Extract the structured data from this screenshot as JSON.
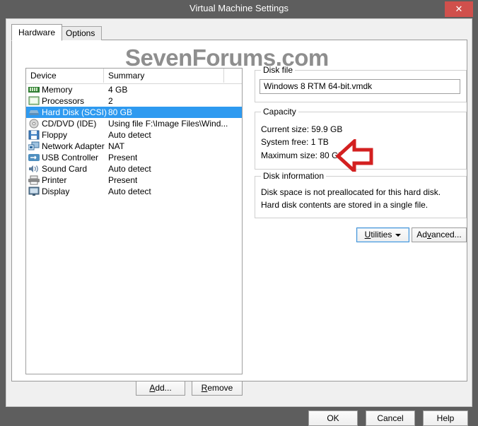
{
  "window": {
    "title": "Virtual Machine Settings",
    "close_label": "✕"
  },
  "watermark": "SevenForums.com",
  "tabs": [
    {
      "label": "Hardware",
      "active": true
    },
    {
      "label": "Options",
      "active": false
    }
  ],
  "device_list": {
    "columns": [
      "Device",
      "Summary",
      ""
    ],
    "rows": [
      {
        "icon": "memory-icon",
        "device": "Memory",
        "summary": "4 GB",
        "selected": false
      },
      {
        "icon": "processor-icon",
        "device": "Processors",
        "summary": "2",
        "selected": false
      },
      {
        "icon": "harddisk-icon",
        "device": "Hard Disk (SCSI)",
        "summary": "80 GB",
        "selected": true
      },
      {
        "icon": "cddvd-icon",
        "device": "CD/DVD (IDE)",
        "summary": "Using file F:\\Image Files\\Wind...",
        "selected": false
      },
      {
        "icon": "floppy-icon",
        "device": "Floppy",
        "summary": "Auto detect",
        "selected": false
      },
      {
        "icon": "network-adapter-icon",
        "device": "Network Adapter",
        "summary": "NAT",
        "selected": false
      },
      {
        "icon": "usb-icon",
        "device": "USB Controller",
        "summary": "Present",
        "selected": false
      },
      {
        "icon": "sound-card-icon",
        "device": "Sound Card",
        "summary": "Auto detect",
        "selected": false
      },
      {
        "icon": "printer-icon",
        "device": "Printer",
        "summary": "Present",
        "selected": false
      },
      {
        "icon": "display-icon",
        "device": "Display",
        "summary": "Auto detect",
        "selected": false
      }
    ]
  },
  "list_buttons": {
    "add": "Add...",
    "remove": "Remove"
  },
  "disk_file": {
    "legend": "Disk file",
    "value": "Windows 8 RTM 64-bit.vmdk",
    "placeholder": ""
  },
  "capacity": {
    "legend": "Capacity",
    "lines": [
      "Current size:  59.9 GB",
      "System free:  1 TB",
      "Maximum size:  80 GB"
    ]
  },
  "disk_information": {
    "legend": "Disk information",
    "lines": [
      "Disk space is not preallocated for this hard disk.",
      "Hard disk contents are stored in a single file."
    ]
  },
  "panel_buttons": {
    "utilities": "Utilities",
    "advanced": "Advanced..."
  },
  "dialog_buttons": {
    "ok": "OK",
    "cancel": "Cancel",
    "help": "Help"
  },
  "annotation": {
    "shape": "left-arrow",
    "color": "#d32020"
  },
  "colors": {
    "frame": "#5e5e5e",
    "client": "#f0f0f0",
    "panel": "#ffffff",
    "selection": "#2e9af0",
    "close_button": "#d0504c",
    "focus_border": "#3c8fd6",
    "watermark": "#8e8e8e"
  }
}
